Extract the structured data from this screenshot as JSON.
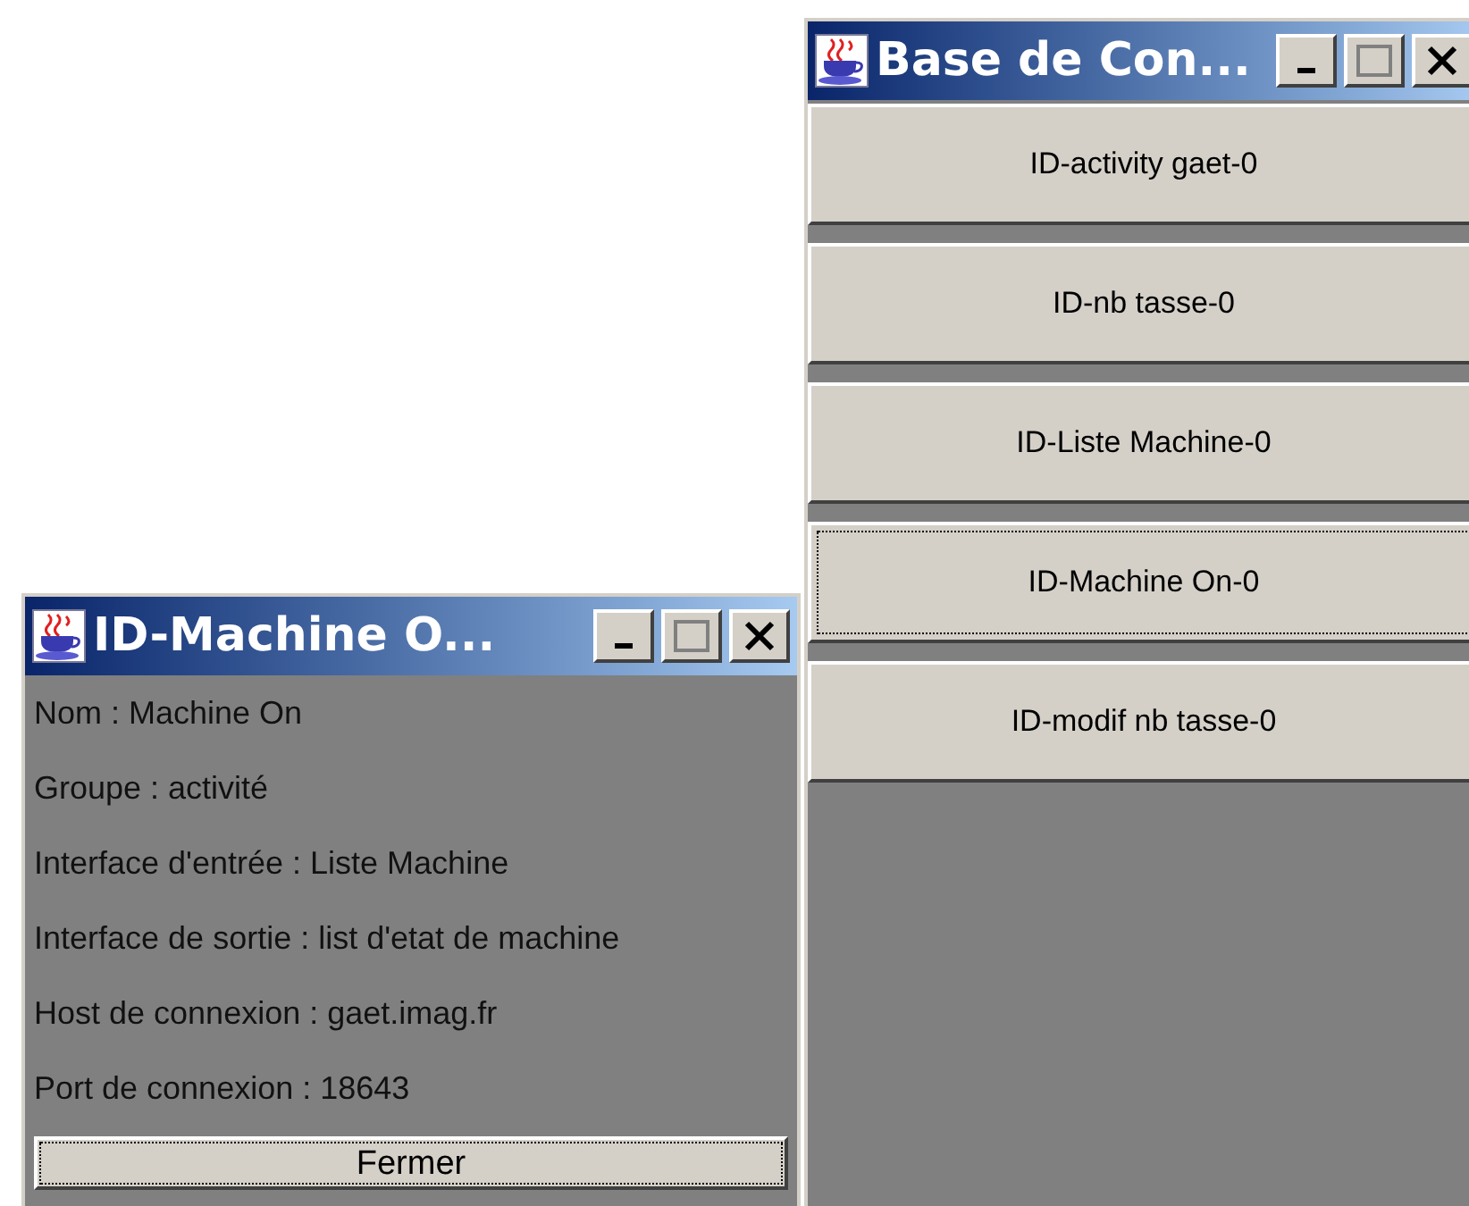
{
  "windows": [
    {
      "title": "Base de Con...",
      "kind": "buttons",
      "buttons": [
        {
          "label": "ID-activity gaet-0",
          "focused": false
        },
        {
          "label": "ID-nb tasse-0",
          "focused": false
        },
        {
          "label": "ID-Liste Machine-0",
          "focused": false
        },
        {
          "label": "ID-Machine On-0",
          "focused": true
        },
        {
          "label": "ID-modif nb tasse-0",
          "focused": false
        }
      ]
    },
    {
      "title": "ID-Machine O...",
      "kind": "details",
      "lines": [
        "Nom : Machine On",
        "Groupe : activité",
        "Interface d'entrée : Liste Machine",
        "Interface de sortie : list d'etat de machine",
        "Host de connexion : gaet.imag.fr",
        "Port de connexion : 18643"
      ],
      "close_button": {
        "label": "Fermer",
        "focused": true
      }
    }
  ]
}
